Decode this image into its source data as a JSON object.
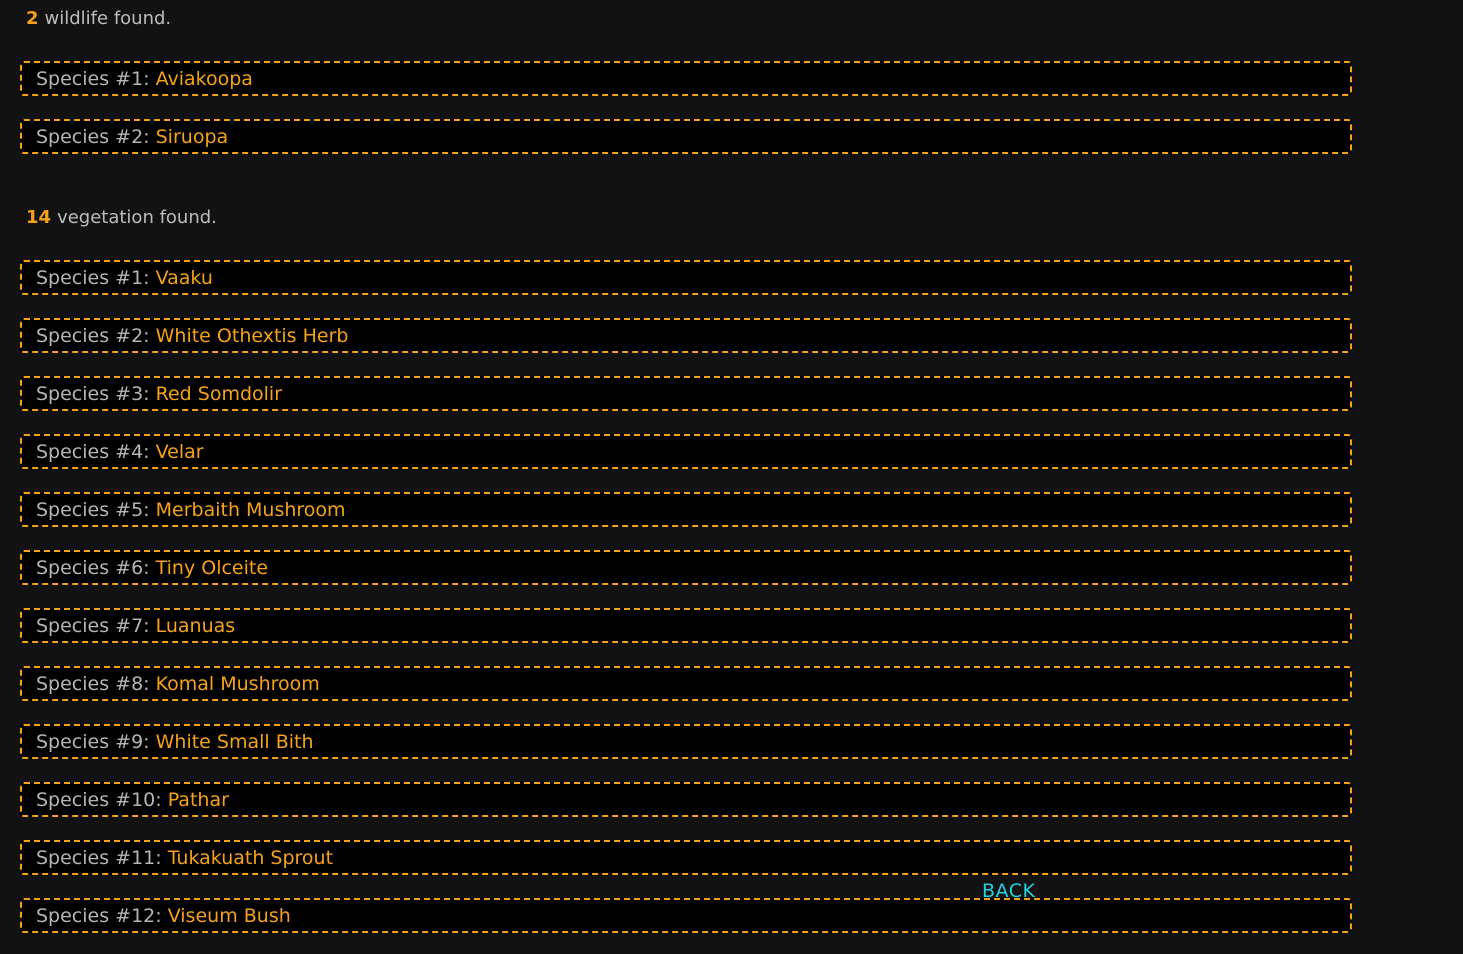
{
  "wildlife": {
    "count": "2",
    "suffix": "wildlife found.",
    "items": [
      {
        "prefix": "Species #1: ",
        "name": "Aviakoopa"
      },
      {
        "prefix": "Species #2: ",
        "name": "Siruopa"
      }
    ]
  },
  "vegetation": {
    "count": "14",
    "suffix": "vegetation found.",
    "items": [
      {
        "prefix": "Species #1: ",
        "name": "Vaaku"
      },
      {
        "prefix": "Species #2: ",
        "name": "White Othextis Herb"
      },
      {
        "prefix": "Species #3: ",
        "name": "Red Somdolir"
      },
      {
        "prefix": "Species #4: ",
        "name": "Velar"
      },
      {
        "prefix": "Species #5: ",
        "name": "Merbaith Mushroom"
      },
      {
        "prefix": "Species #6: ",
        "name": "Tiny Olceite"
      },
      {
        "prefix": "Species #7: ",
        "name": "Luanuas"
      },
      {
        "prefix": "Species #8: ",
        "name": "Komal Mushroom"
      },
      {
        "prefix": "Species #9: ",
        "name": "White Small Bith"
      },
      {
        "prefix": "Species #10: ",
        "name": "Pathar"
      },
      {
        "prefix": "Species #11: ",
        "name": "Tukakuath Sprout"
      },
      {
        "prefix": "Species #12: ",
        "name": "Viseum Bush"
      }
    ]
  },
  "back_label": "BACK",
  "colors": {
    "accent": "#f5a21a",
    "link": "#1fd3e0",
    "background": "#121212"
  }
}
